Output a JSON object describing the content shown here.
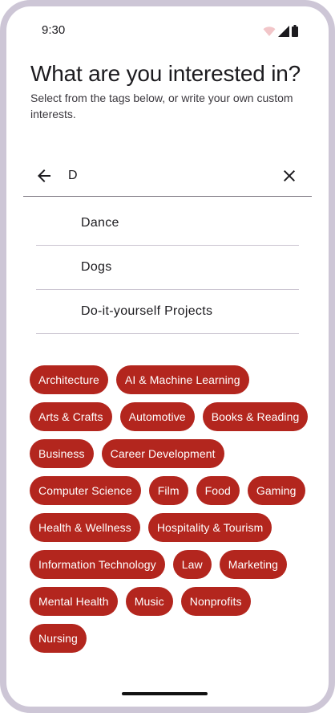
{
  "status_bar": {
    "time": "9:30",
    "icons": [
      "wifi-icon",
      "signal-icon",
      "battery-icon"
    ]
  },
  "header": {
    "title": "What are you interested in?",
    "subtitle": "Select from the tags below, or write your own custom interests."
  },
  "search": {
    "value": "D",
    "back_icon": "arrow-back-icon",
    "clear_icon": "close-icon"
  },
  "suggestions": [
    {
      "label": "Dance"
    },
    {
      "label": "Dogs"
    },
    {
      "label": "Do-it-yourself Projects"
    }
  ],
  "tags": [
    {
      "label": "Architecture"
    },
    {
      "label": "AI & Machine Learning"
    },
    {
      "label": "Arts & Crafts"
    },
    {
      "label": "Automotive"
    },
    {
      "label": "Books & Reading"
    },
    {
      "label": "Business"
    },
    {
      "label": "Career Development"
    },
    {
      "label": "Computer Science"
    },
    {
      "label": "Film"
    },
    {
      "label": "Food"
    },
    {
      "label": "Gaming"
    },
    {
      "label": "Health & Wellness"
    },
    {
      "label": "Hospitality & Tourism"
    },
    {
      "label": "Information Technology"
    },
    {
      "label": "Law"
    },
    {
      "label": "Marketing"
    },
    {
      "label": "Mental Health"
    },
    {
      "label": "Music"
    },
    {
      "label": "Nonprofits"
    },
    {
      "label": "Nursing"
    }
  ],
  "colors": {
    "chip_background": "#b3261e",
    "chip_text": "#ffffff",
    "frame": "#cdc6d6"
  }
}
